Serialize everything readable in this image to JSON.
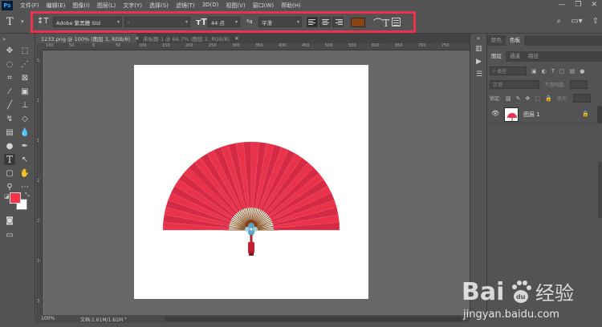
{
  "app": {
    "logo": "Ps"
  },
  "menu": [
    "文件(F)",
    "编辑(E)",
    "图像(I)",
    "图层(L)",
    "文字(Y)",
    "选择(S)",
    "滤镜(T)",
    "3D(D)",
    "视图(V)",
    "窗口(W)",
    "帮助(H)"
  ],
  "options_bar": {
    "font_family": "Adobe 繁黑體 Std",
    "font_style": "-",
    "font_size": "44 点",
    "anti_alias": "平滑",
    "text_color": "#8b4513",
    "highlight_color": "#e8334a",
    "align": [
      "left",
      "center",
      "right"
    ],
    "active_align": "left"
  },
  "tabs": [
    {
      "label": "1233.png @ 100% (图层 1, RGB/8)",
      "active": true
    },
    {
      "label": "未标题-1 @ 66.7% (图层 2, RGB/8)",
      "active": false
    }
  ],
  "ruler": {
    "h_ticks": [
      "100",
      "50",
      "0",
      "50",
      "100",
      "150",
      "200",
      "250",
      "300",
      "350",
      "400",
      "450",
      "500",
      "550",
      "600",
      "650",
      "700",
      "750"
    ]
  },
  "colors": {
    "foreground": "#f5344a",
    "background": "#ffffff"
  },
  "status": {
    "zoom": "100%",
    "doc_info": "文档:1.61M/1.61M"
  },
  "panels": {
    "top_tabs": [
      "颜色",
      "色板"
    ],
    "layer_tabs": [
      "图层",
      "通道",
      "路径"
    ],
    "filter_kind": "类型",
    "blend_mode": "正常",
    "opacity_label": "不透明度:",
    "lock_label": "锁定:",
    "fill_label": "填充:",
    "layer_name": "图层 1"
  },
  "watermark": {
    "brand": "Bai",
    "paw": "du",
    "suffix": "经验",
    "url": "jingyan.baidu.com"
  }
}
